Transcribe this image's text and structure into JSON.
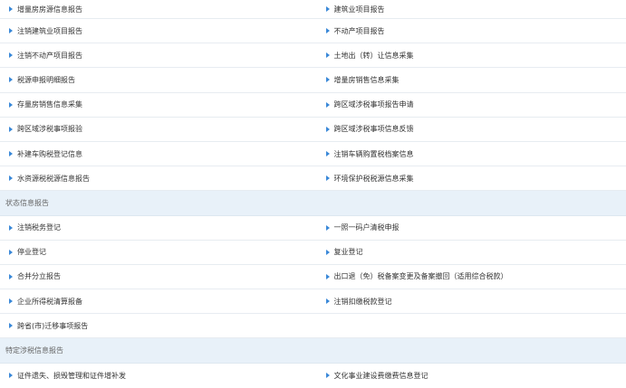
{
  "accent_color": "#3a88d8",
  "arrow_icon": "caret-right-icon",
  "group1": {
    "rows": [
      [
        "增量房房源信息报告",
        "建筑业项目报告"
      ],
      [
        "注销建筑业项目报告",
        "不动产项目报告"
      ],
      [
        "注销不动产项目报告",
        "土地出（转）让信息采集"
      ],
      [
        "税源申报明细报告",
        "增量房销售信息采集"
      ],
      [
        "存量房销售信息采集",
        "跨区域涉税事项报告申请"
      ],
      [
        "跨区域涉税事项报验",
        "跨区域涉税事项信息反馈"
      ],
      [
        "补建车购税登记信息",
        "注销车辆购置税档案信息"
      ],
      [
        "水资源税税源信息报告",
        "环境保护税税源信息采集"
      ]
    ]
  },
  "group2": {
    "title": "状态信息报告",
    "rows": [
      [
        "注销税务登记",
        "一照一码户清税申报"
      ],
      [
        "停业登记",
        "复业登记"
      ],
      [
        "合并分立报告",
        "出口退（免）税备案变更及备案撤回（适用综合税款）"
      ],
      [
        "企业所得税清算报备",
        "注销扣缴税款登记"
      ],
      [
        "跨省(市)迁移事项报告",
        ""
      ]
    ]
  },
  "group3": {
    "title": "特定涉税信息报告",
    "rows": [
      [
        "证件遗失、损毁管理和证件增补发",
        "文化事业建设费缴费信息登记"
      ]
    ]
  }
}
